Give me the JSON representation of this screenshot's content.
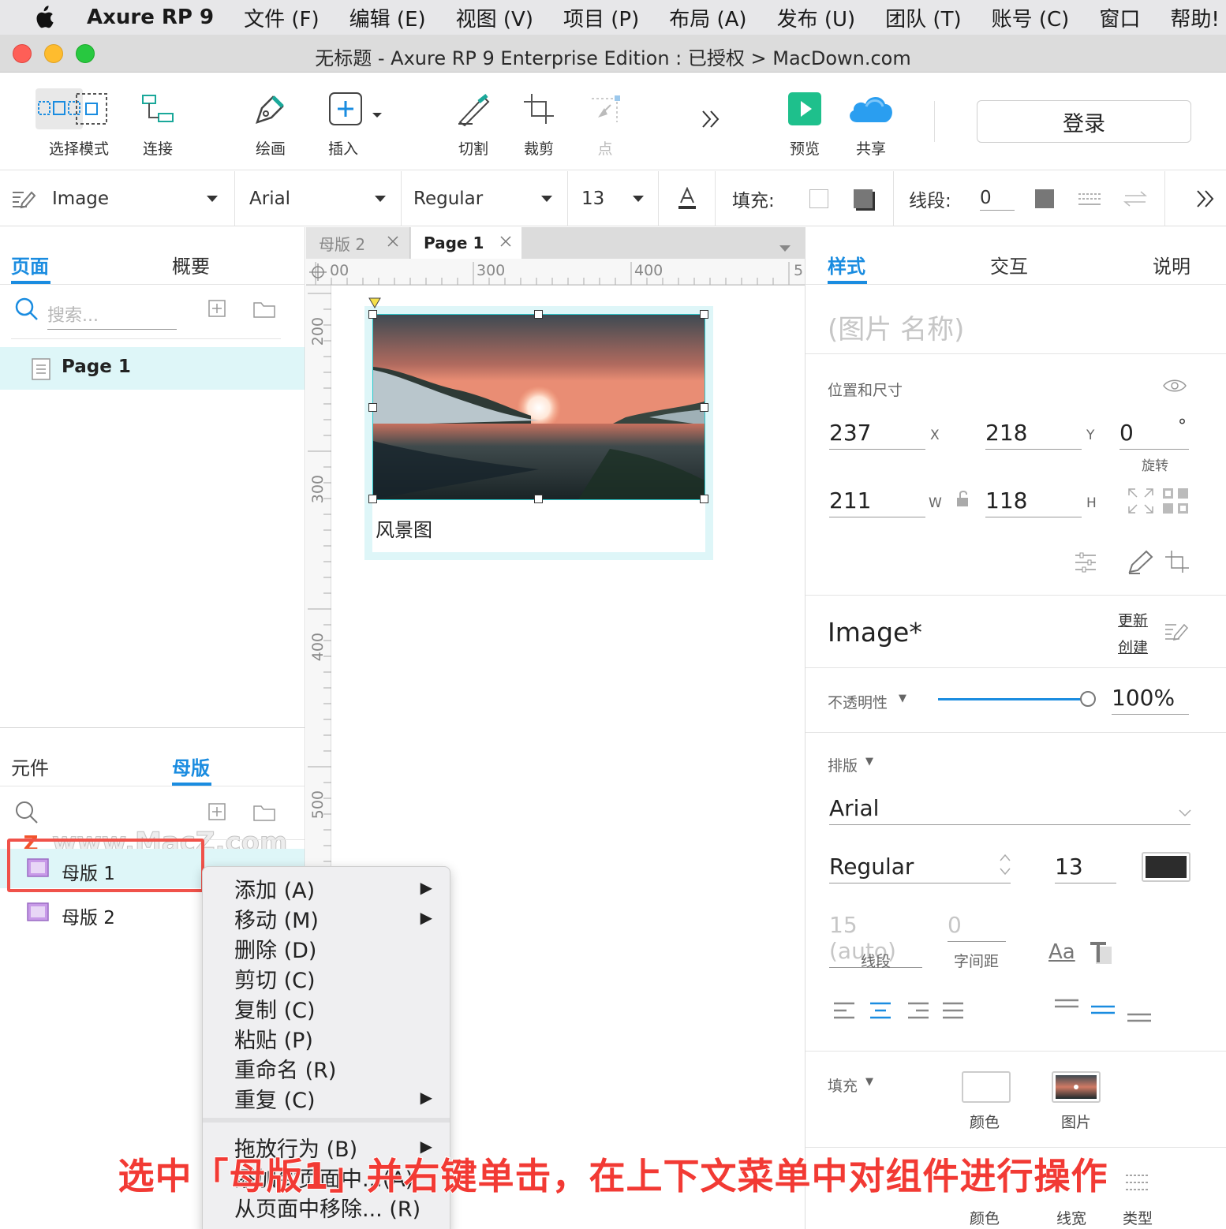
{
  "menubar": {
    "app_name": "Axure RP 9",
    "items": [
      "文件 (F)",
      "编辑 (E)",
      "视图 (V)",
      "项目 (P)",
      "布局 (A)",
      "发布 (U)",
      "团队 (T)",
      "账号 (C)",
      "窗口",
      "帮助!"
    ]
  },
  "window": {
    "title": "无标题 - Axure RP 9 Enterprise Edition : 已授权 > MacDown.com"
  },
  "toolbar": {
    "select_mode": "选择模式",
    "connect": "连接",
    "draw": "绘画",
    "insert": "插入",
    "slice": "切割",
    "crop": "裁剪",
    "point": "点",
    "preview": "预览",
    "share": "共享",
    "login": "登录"
  },
  "formatbar": {
    "style": "Image",
    "font": "Arial",
    "weight": "Regular",
    "size": "13",
    "fill_label": "填充:",
    "stroke_label": "线段:",
    "stroke_value": "0"
  },
  "left_panel": {
    "pages_tab": "页面",
    "outline_tab": "概要",
    "search_placeholder": "搜索...",
    "page_item": "Page 1",
    "widgets_tab": "元件",
    "masters_tab": "母版",
    "masters": [
      "母版 1",
      "母版 2"
    ],
    "watermark": "www.MacZ.com"
  },
  "canvas": {
    "tabs": [
      "母版 2",
      "Page 1"
    ],
    "ruler_h": [
      "00",
      "300",
      "400",
      "5"
    ],
    "ruler_v": [
      "200",
      "300",
      "400",
      "500"
    ],
    "image_caption": "风景图"
  },
  "right_panel": {
    "tabs": [
      "样式",
      "交互",
      "说明"
    ],
    "name_placeholder": "(图片 名称)",
    "position_size": "位置和尺寸",
    "x": "237",
    "x_label": "X",
    "y": "218",
    "y_label": "Y",
    "rotation": "0",
    "rotation_unit": "°",
    "rotation_label": "旋转",
    "w": "211",
    "w_label": "W",
    "h": "118",
    "h_label": "H",
    "style_name": "Image*",
    "update": "更新",
    "create": "创建",
    "opacity_label": "不透明性",
    "opacity_value": "100%",
    "opacity": 1.0,
    "typography_label": "排版",
    "font": "Arial",
    "weight": "Regular",
    "font_size": "13",
    "line_spacing": "15 (auto)",
    "line_spacing_label": "线段",
    "char_spacing": "0",
    "char_spacing_label": "字间距",
    "fill_label": "填充",
    "fill_color_label": "颜色",
    "fill_image_label": "图片",
    "border_color_label": "颜色",
    "border_width_label": "线宽",
    "border_type_label": "类型",
    "text_color": "#2c2c2c"
  },
  "context_menu": {
    "items": [
      {
        "label": "添加 (A)",
        "submenu": true
      },
      {
        "label": "移动 (M)",
        "submenu": true
      },
      {
        "label": "删除 (D)",
        "submenu": false
      },
      {
        "label": "剪切 (C)",
        "submenu": false
      },
      {
        "label": "复制 (C)",
        "submenu": false
      },
      {
        "label": "粘贴 (P)",
        "submenu": false
      },
      {
        "label": "重命名 (R)",
        "submenu": false
      },
      {
        "label": "重复 (C)",
        "submenu": true
      },
      {
        "label": "拖放行为 (B)",
        "submenu": true
      },
      {
        "label": "添加到页面中...(A)",
        "submenu": false
      },
      {
        "label": "从页面中移除... (R)",
        "submenu": false
      }
    ]
  },
  "caption": "选中「母版1」并右键单击，在上下文菜单中对组件进行操作",
  "colors": {
    "accent": "#1a8ce0",
    "highlight": "#def6f8",
    "annotation_red": "#f0524a",
    "preview_green": "#1ec08c"
  }
}
